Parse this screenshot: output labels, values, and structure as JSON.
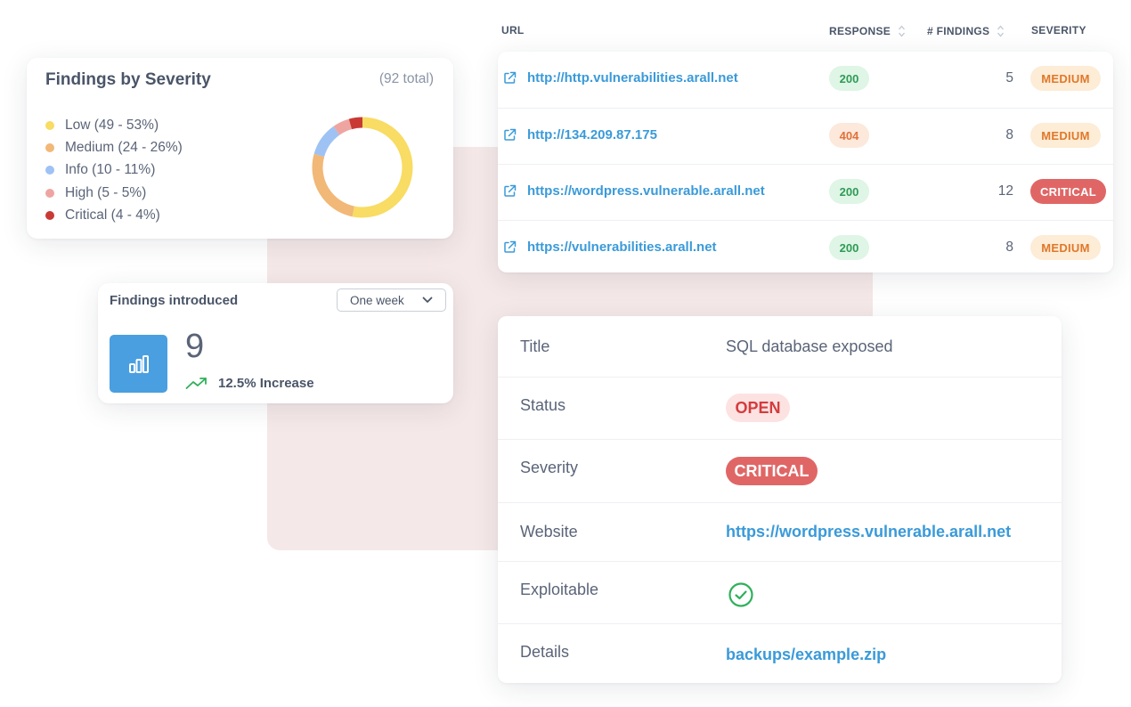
{
  "severity_summary": {
    "title": "Findings by Severity",
    "total": "(92 total)",
    "legend": [
      {
        "label": "Low (49 - 53%)",
        "color": "#f8dc63",
        "count": 49
      },
      {
        "label": "Medium (24 - 26%)",
        "color": "#f1b877",
        "count": 24
      },
      {
        "label": "Info (10 - 11%)",
        "color": "#9ec2f4",
        "count": 10
      },
      {
        "label": "High (5 - 5%)",
        "color": "#eea5a1",
        "count": 5
      },
      {
        "label": "Critical (4 - 4%)",
        "color": "#c93a35",
        "count": 4
      }
    ]
  },
  "findings_introduced": {
    "title": "Findings introduced",
    "period": "One week",
    "count": "9",
    "change": "12.5% Increase",
    "tile_icon": "bar-chart-icon",
    "trend_icon": "trending-up-icon"
  },
  "url_table": {
    "headers": {
      "url": "URL",
      "response": "RESPONSE",
      "findings": "# FINDINGS",
      "severity": "SEVERITY"
    },
    "rows": [
      {
        "url": "http://http.vulnerabilities.arall.net",
        "response": "200",
        "response_kind": "ok",
        "findings": "5",
        "severity": "MEDIUM"
      },
      {
        "url": "http://134.209.87.175",
        "response": "404",
        "response_kind": "warn",
        "findings": "8",
        "severity": "MEDIUM"
      },
      {
        "url": "https://wordpress.vulnerable.arall.net",
        "response": "200",
        "response_kind": "ok",
        "findings": "12",
        "severity": "CRITICAL"
      },
      {
        "url": "https://vulnerabilities.arall.net",
        "response": "200",
        "response_kind": "ok",
        "findings": "8",
        "severity": "MEDIUM"
      }
    ]
  },
  "finding_detail": {
    "title_label": "Title",
    "title_value": "SQL database exposed",
    "status_label": "Status",
    "status_value": "OPEN",
    "severity_label": "Severity",
    "severity_value": "CRITICAL",
    "website_label": "Website",
    "website_value": "https://wordpress.vulnerable.arall.net",
    "exploitable_label": "Exploitable",
    "exploitable_icon": "check-circle-icon",
    "details_label": "Details",
    "details_value": "backups/example.zip"
  },
  "colors": {
    "link": "#3a9ad9",
    "tile": "#4a9fe0",
    "critical": "#e06666",
    "backdrop": "#f5e8e8",
    "success": "#2fb05a"
  }
}
